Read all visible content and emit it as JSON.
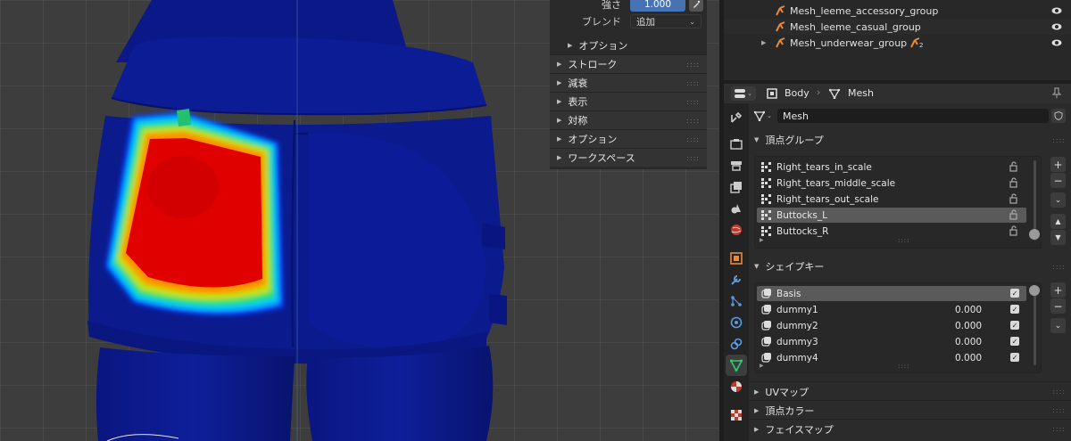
{
  "tool_settings": {
    "strength_label": "強さ",
    "strength_value": "1.000",
    "blend_label": "ブレンド",
    "blend_value": "追加",
    "options_sub": "オプション",
    "sections": [
      "ストローク",
      "減衰",
      "表示",
      "対称",
      "オプション",
      "ワークスペース"
    ]
  },
  "outliner": {
    "rows": [
      "Mesh_leeme_accessory_group",
      "Mesh_leeme_casual_group",
      "Mesh_underwear_group"
    ],
    "modifier_count": "2"
  },
  "properties": {
    "breadcrumb_object": "Body",
    "breadcrumb_data": "Mesh",
    "mesh_name": "Mesh",
    "vertex_groups_title": "頂点グループ",
    "vertex_groups": [
      "Right_tears_in_scale",
      "Right_tears_middle_scale",
      "Right_tears_out_scale",
      "Buttocks_L",
      "Buttocks_R"
    ],
    "selected_vertex_group": "Buttocks_L",
    "shape_keys_title": "シェイプキー",
    "shape_keys": [
      {
        "name": "Basis",
        "value": ""
      },
      {
        "name": "dummy1",
        "value": "0.000"
      },
      {
        "name": "dummy2",
        "value": "0.000"
      },
      {
        "name": "dummy3",
        "value": "0.000"
      },
      {
        "name": "dummy4",
        "value": "0.000"
      }
    ],
    "collapsed_panels": [
      "UVマップ",
      "頂点カラー",
      "フェイスマップ"
    ]
  },
  "icons": [
    "tool-icon",
    "render-icon",
    "output-icon",
    "view-layer-icon",
    "scene-icon",
    "world-icon",
    "object-icon",
    "modifier-icon",
    "particles-icon",
    "physics-icon",
    "constraints-icon",
    "mesh-data-icon",
    "material-icon",
    "texture-icon",
    "eye-icon",
    "lock-icon",
    "pin-icon"
  ],
  "colors": {
    "accent_blue": "#4772b3",
    "mesh_blue": "#0b1a8c",
    "weight_red": "#d40000"
  }
}
